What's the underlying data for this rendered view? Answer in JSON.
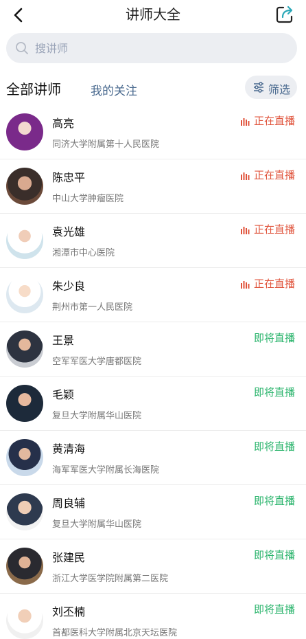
{
  "header": {
    "title": "讲师大全",
    "back_icon": "back-arrow-icon",
    "share_icon": "share-icon"
  },
  "search": {
    "placeholder": "搜讲师",
    "value": ""
  },
  "tabs": {
    "all": "全部讲师",
    "following": "我的关注",
    "filter": "筛选"
  },
  "colors": {
    "live": "#e0533b",
    "soon": "#27b36a",
    "tab_inactive": "#4a6a8f",
    "search_bg": "#eceef2"
  },
  "lecturers": [
    {
      "name": "高亮",
      "hospital": "同济大学附属第十人民医院",
      "status": "正在直播",
      "live": true
    },
    {
      "name": "陈忠平",
      "hospital": "中山大学肿瘤医院",
      "status": "正在直播",
      "live": true
    },
    {
      "name": "袁光雄",
      "hospital": "湘潭市中心医院",
      "status": "正在直播",
      "live": true
    },
    {
      "name": "朱少良",
      "hospital": "荆州市第一人民医院",
      "status": "正在直播",
      "live": true
    },
    {
      "name": "王景",
      "hospital": "空军军医大学唐都医院",
      "status": "即将直播",
      "live": false
    },
    {
      "name": "毛颖",
      "hospital": "复旦大学附属华山医院",
      "status": "即将直播",
      "live": false
    },
    {
      "name": "黄清海",
      "hospital": "海军军医大学附属长海医院",
      "status": "即将直播",
      "live": false
    },
    {
      "name": "周良辅",
      "hospital": "复旦大学附属华山医院",
      "status": "即将直播",
      "live": false
    },
    {
      "name": "张建民",
      "hospital": "浙江大学医学院附属第二医院",
      "status": "即将直播",
      "live": false
    },
    {
      "name": "刘丕楠",
      "hospital": "首都医科大学附属北京天坛医院",
      "status": "即将直播",
      "live": false
    }
  ]
}
